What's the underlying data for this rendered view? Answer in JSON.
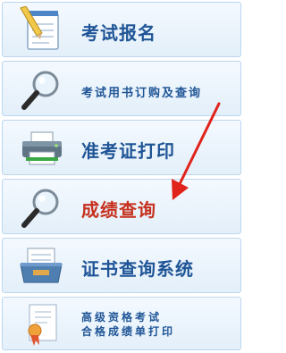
{
  "menu": {
    "items": [
      {
        "label": "考试报名",
        "icon": "notepad-pencil-icon"
      },
      {
        "label": "考试用书订购及查询",
        "icon": "magnifier-icon"
      },
      {
        "label": "准考证打印",
        "icon": "printer-icon"
      },
      {
        "label": "成绩查询",
        "icon": "magnifier-icon",
        "highlight": "#c6301d"
      },
      {
        "label": "证书查询系统",
        "icon": "file-tray-icon"
      },
      {
        "line1": "高级资格考试",
        "line2": "合格成绩单打印",
        "icon": "certificate-icon"
      }
    ]
  },
  "annotation": {
    "icon": "red-arrow-icon",
    "color": "#e0231b"
  },
  "colors": {
    "label_blue": "#1f5596",
    "border": "#bcd6ee"
  }
}
